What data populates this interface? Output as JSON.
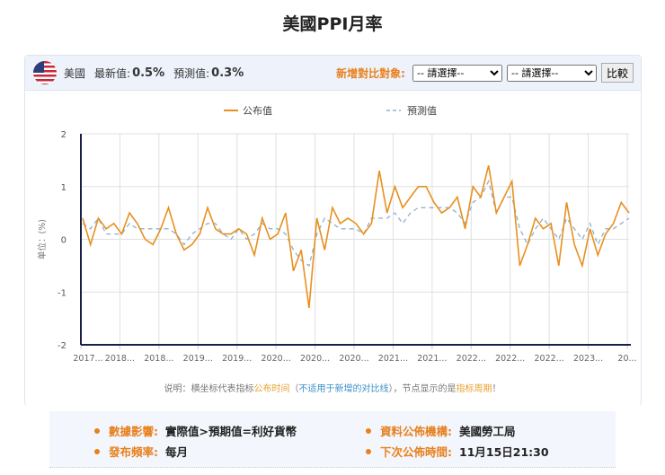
{
  "page_title": "美國PPI月率",
  "header": {
    "country": "美國",
    "latest_label": "最新值:",
    "latest_value": "0.5%",
    "forecast_label": "預測值:",
    "forecast_value": "0.3%",
    "compare_label": "新增對比對象:",
    "select1": "-- 請選擇--",
    "select2": "-- 請選擇--",
    "compare_button": "比較"
  },
  "note": {
    "p1": "说明：横坐标代表指标",
    "p2": "公布时间",
    "p3": "（",
    "p4": "不适用于新增的对比线",
    "p5": "），节点显示的是",
    "p6": "指标周期",
    "p7": "！"
  },
  "info": {
    "impact_label": "數據影響:",
    "impact_value": "實際值>預期值=利好貨幣",
    "agency_label": "資料公佈機構:",
    "agency_value": "美國勞工局",
    "freq_label": "發布頻率:",
    "freq_value": "每月",
    "next_label": "下次公佈時間:",
    "next_value": "11月15日21:30"
  },
  "colors": {
    "published": "#e8901e",
    "forecast": "#8fb0d0",
    "axis": "#1a1f4a"
  },
  "chart_data": {
    "type": "line",
    "title": "美國PPI月率",
    "ylabel": "单位：(%)",
    "ylim": [
      -2,
      2
    ],
    "yticks": [
      2,
      1,
      0,
      -1,
      -2
    ],
    "grid": true,
    "legend": "top",
    "xtick_labels": [
      "2017...",
      "2018...",
      "2018...",
      "2019...",
      "2019...",
      "2020...",
      "2020...",
      "2020...",
      "2021...",
      "2021...",
      "2022...",
      "2022...",
      "2022...",
      "2023...",
      "20..."
    ],
    "series": [
      {
        "name": "公布值",
        "values": [
          0.4,
          -0.1,
          0.4,
          0.2,
          0.3,
          0.1,
          0.5,
          0.3,
          0,
          -0.1,
          0.2,
          0.6,
          0.1,
          -0.2,
          -0.1,
          0.1,
          0.6,
          0.2,
          0.1,
          0.1,
          0.2,
          0.1,
          -0.3,
          0.4,
          0,
          0.1,
          0.5,
          -0.6,
          -0.2,
          -1.3,
          0.4,
          -0.2,
          0.6,
          0.3,
          0.4,
          0.3,
          0.1,
          0.3,
          1.3,
          0.5,
          1.0,
          0.6,
          0.8,
          1.0,
          1.0,
          0.7,
          0.5,
          0.6,
          0.8,
          0.2,
          1.0,
          0.8,
          1.4,
          0.5,
          0.8,
          1.1,
          -0.5,
          -0.1,
          0.4,
          0.2,
          0.3,
          -0.5,
          0.7,
          -0.1,
          -0.5,
          0.2,
          -0.3,
          0.1,
          0.3,
          0.7,
          0.5
        ]
      },
      {
        "name": "預測值",
        "values": [
          0.3,
          0.2,
          0.4,
          0.1,
          0.1,
          0.1,
          0.3,
          0.2,
          0.2,
          0.2,
          0.2,
          0.2,
          0.1,
          -0.1,
          0.1,
          0.2,
          0.3,
          0.3,
          0.1,
          0,
          0.2,
          0,
          0.1,
          0.3,
          0.2,
          0.2,
          0.1,
          -0.2,
          -0.4,
          -0.5,
          0.1,
          0.4,
          0.3,
          0.2,
          0.2,
          0.2,
          0.1,
          0.4,
          0.4,
          0.4,
          0.5,
          0.3,
          0.5,
          0.6,
          0.6,
          0.6,
          0.6,
          0.6,
          0.5,
          0.3,
          0.7,
          0.8,
          1.1,
          0.5,
          0.8,
          0.8,
          0.2,
          -0.1,
          0.2,
          0.4,
          0.2,
          0,
          0.4,
          0.2,
          0,
          0.3,
          -0.1,
          0.2,
          0.2,
          0.3,
          0.4
        ]
      }
    ]
  }
}
